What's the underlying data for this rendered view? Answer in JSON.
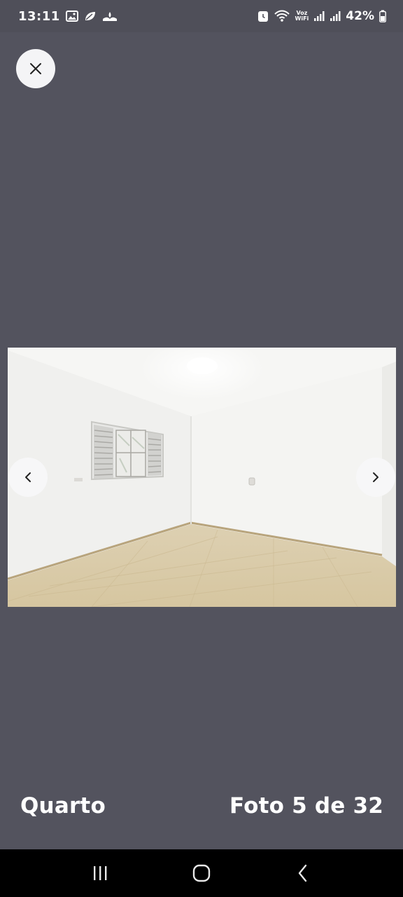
{
  "status_bar": {
    "time": "13:11",
    "network_label_top": "Voz",
    "network_label_bottom": "WiFi",
    "battery": "42%"
  },
  "close_button": {
    "icon": "close-icon"
  },
  "photo": {
    "alt": "Quarto",
    "prev_icon": "chevron-left-icon",
    "next_icon": "chevron-right-icon"
  },
  "caption": {
    "room_label": "Quarto",
    "counter": "Foto 5 de 32"
  },
  "system_nav": {
    "recents_icon": "recents-icon",
    "home_icon": "home-icon",
    "back_icon": "back-icon"
  },
  "colors": {
    "background": "#53535e",
    "status_bar": "#4f4f59",
    "button_bg": "#f4f4f6",
    "nav_bar": "#000000"
  }
}
